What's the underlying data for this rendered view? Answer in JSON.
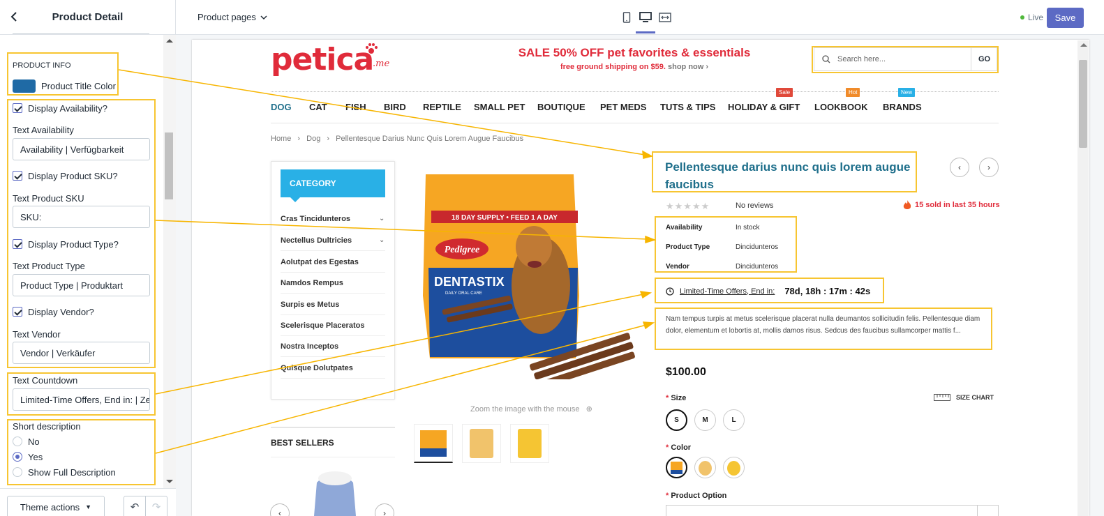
{
  "sidebar": {
    "title": "Product Detail",
    "section_heading": "PRODUCT INFO",
    "title_color_label": "Product Title Color",
    "title_color": "#1f6aa5",
    "display_availability": "Display Availability?",
    "text_availability_label": "Text Availability",
    "text_availability_value": "Availability | Verfügbarkeit",
    "display_sku": "Display Product SKU?",
    "text_sku_label": "Text Product SKU",
    "text_sku_value": "SKU:",
    "display_type": "Display Product Type?",
    "text_type_label": "Text Product Type",
    "text_type_value": "Product Type | Produktart",
    "display_vendor": "Display Vendor?",
    "text_vendor_label": "Text Vendor",
    "text_vendor_value": "Vendor | Verkäufer",
    "text_countdown_label": "Text Countdown",
    "text_countdown_value": "Limited-Time Offers, End in: | Ze",
    "short_desc_label": "Short description",
    "short_desc_options": [
      "No",
      "Yes",
      "Show Full Description"
    ],
    "short_desc_selected": "Yes",
    "theme_actions": "Theme actions"
  },
  "topbar": {
    "page_selector": "Product pages",
    "live": "Live",
    "save": "Save"
  },
  "store": {
    "logo": "petica",
    "logo_suffix": ".me",
    "sale_headline": "SALE 50% OFF pet favorites & essentials",
    "shipping": "free ground shipping on $59.",
    "shop_now": "shop now ›",
    "search_placeholder": "Search here...",
    "search_go": "GO",
    "nav": [
      "DOG",
      "CAT",
      "FISH",
      "BIRD",
      "REPTILE",
      "SMALL PET",
      "BOUTIQUE",
      "PET MEDS",
      "TUTS & TIPS",
      "HOLIDAY & GIFT",
      "LOOKBOOK",
      "BRANDS"
    ],
    "nav_badges": {
      "sale": "Sale",
      "hot": "Hot",
      "new": "New"
    },
    "breadcrumb": [
      "Home",
      "Dog",
      "Pellentesque Darius Nunc Quis Lorem Augue Faucibus"
    ],
    "category_title": "CATEGORY",
    "categories": [
      "Cras Tincidunteros",
      "Nectellus Dultricies",
      "Aolutpat des Egestas",
      "Namdos Rempus",
      "Surpis es Metus",
      "Scelerisque Placeratos",
      "Nostra Inceptos",
      "Quisque Dolutpates"
    ],
    "zoom_hint": "Zoom the image with the mouse",
    "best_sellers": "BEST SELLERS",
    "product_title": "Pellentesque darius nunc quis lorem augue faucibus",
    "reviews": "No reviews",
    "sold": "15 sold in last 35 hours",
    "meta": [
      {
        "k": "Availability",
        "v": "In stock"
      },
      {
        "k": "Product Type",
        "v": "Dincidunteros"
      },
      {
        "k": "Vendor",
        "v": "Dincidunteros"
      }
    ],
    "countdown_label": "Limited-Time Offers, End in:",
    "countdown_time": "78d, 18h : 17m : 42s",
    "description": "Nam tempus turpis at metus scelerisque placerat nulla deumantos sollicitudin felis. Pellentesque diam dolor, elementum et lobortis at, mollis damos risus. Sedcus des faucibus sullamcorper mattis f...",
    "price": "$100.00",
    "size_label": "Size",
    "size_chart": "SIZE CHART",
    "sizes": [
      "S",
      "M",
      "L"
    ],
    "color_label": "Color",
    "option_label": "Product Option",
    "bag_top_banner": "18 DAY SUPPLY • FEED 1 A DAY",
    "bag_brand": "Pedigree",
    "bag_product": "DENTASTIX",
    "bag_subline": "DAILY ORAL CARE"
  }
}
